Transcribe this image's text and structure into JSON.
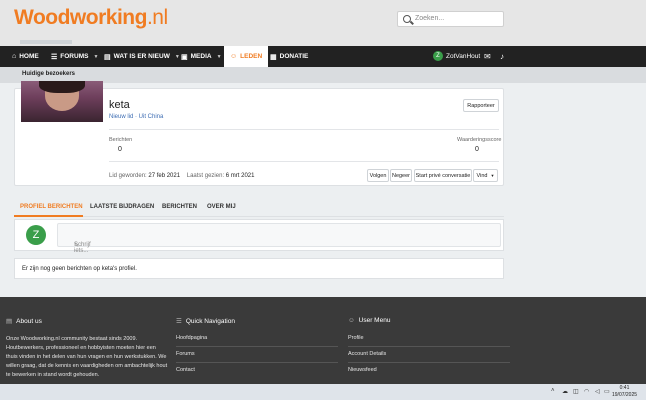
{
  "header": {
    "logo_main": "Woodworking",
    "logo_tld": ".nl",
    "search_placeholder": "Zoeken..."
  },
  "nav": {
    "items": [
      {
        "label": "HOME",
        "icon": "home-icon",
        "glyph": "⌂"
      },
      {
        "label": "FORUMS",
        "icon": "forum-icon",
        "glyph": "☰"
      },
      {
        "label": "WAT IS ER NIEUW",
        "icon": "news-icon",
        "glyph": "▤"
      },
      {
        "label": "MEDIA",
        "icon": "media-icon",
        "glyph": "▣"
      },
      {
        "label": "LEDEN",
        "icon": "members-icon",
        "glyph": "☺"
      },
      {
        "label": "DONATIE",
        "icon": "donate-icon",
        "glyph": "▦"
      }
    ],
    "user": "ZotVanHout",
    "user_initial": "Z"
  },
  "subnav": {
    "current": "Huidige bezoekers"
  },
  "profile": {
    "username": "keta",
    "subtitle": "Nieuw lid · Uit China",
    "report_label": "Rapporteer",
    "stats": [
      {
        "label": "Berichten",
        "value": "0"
      },
      {
        "label": "Waarderingsscore",
        "value": "0"
      }
    ],
    "joined_label": "Lid geworden:",
    "joined_value": "27 feb 2021",
    "seen_label": "Laatst gezien:",
    "seen_value": "6 mrt 2021",
    "actions": {
      "follow": "Volgen",
      "ignore": "Negeer",
      "start_conversation": "Start privé conversatie",
      "find": "Vind"
    }
  },
  "tabs": [
    {
      "label": "PROFIEL BERICHTEN",
      "active": true
    },
    {
      "label": "LAATSTE BIJDRAGEN",
      "active": false
    },
    {
      "label": "BERICHTEN",
      "active": false
    },
    {
      "label": "OVER MIJ",
      "active": false
    }
  ],
  "composer": {
    "avatar_initial": "Z",
    "placeholder": "Schrijf iets..."
  },
  "empty_message": "Er zijn nog geen berichten op keta's profiel.",
  "footer": {
    "about": {
      "title": "About us",
      "text": "Onze Woodworking.nl community bestaat sinds 2009. Houtbewerkers, professioneel en hobbyisten moeten hier een thuis vinden in het delen van hun vragen en hun werkstukken. We willen graag, dat de kennis en vaardigheden om ambachtelijk hout te bewerken in stand wordt gehouden."
    },
    "quicknav": {
      "title": "Quick Navigation",
      "links": [
        "Hoofdpagina",
        "Forums",
        "Contact"
      ]
    },
    "usermenu": {
      "title": "User Menu",
      "links": [
        "Profile",
        "Account Details",
        "Nieuwsfeed"
      ]
    }
  },
  "taskbar": {
    "time": "0:41",
    "date": "19/07/2025"
  },
  "colors": {
    "accent": "#f07c22",
    "nav_bg": "#222222",
    "footer_bg": "#3a3a3a",
    "link": "#3d6db3"
  }
}
